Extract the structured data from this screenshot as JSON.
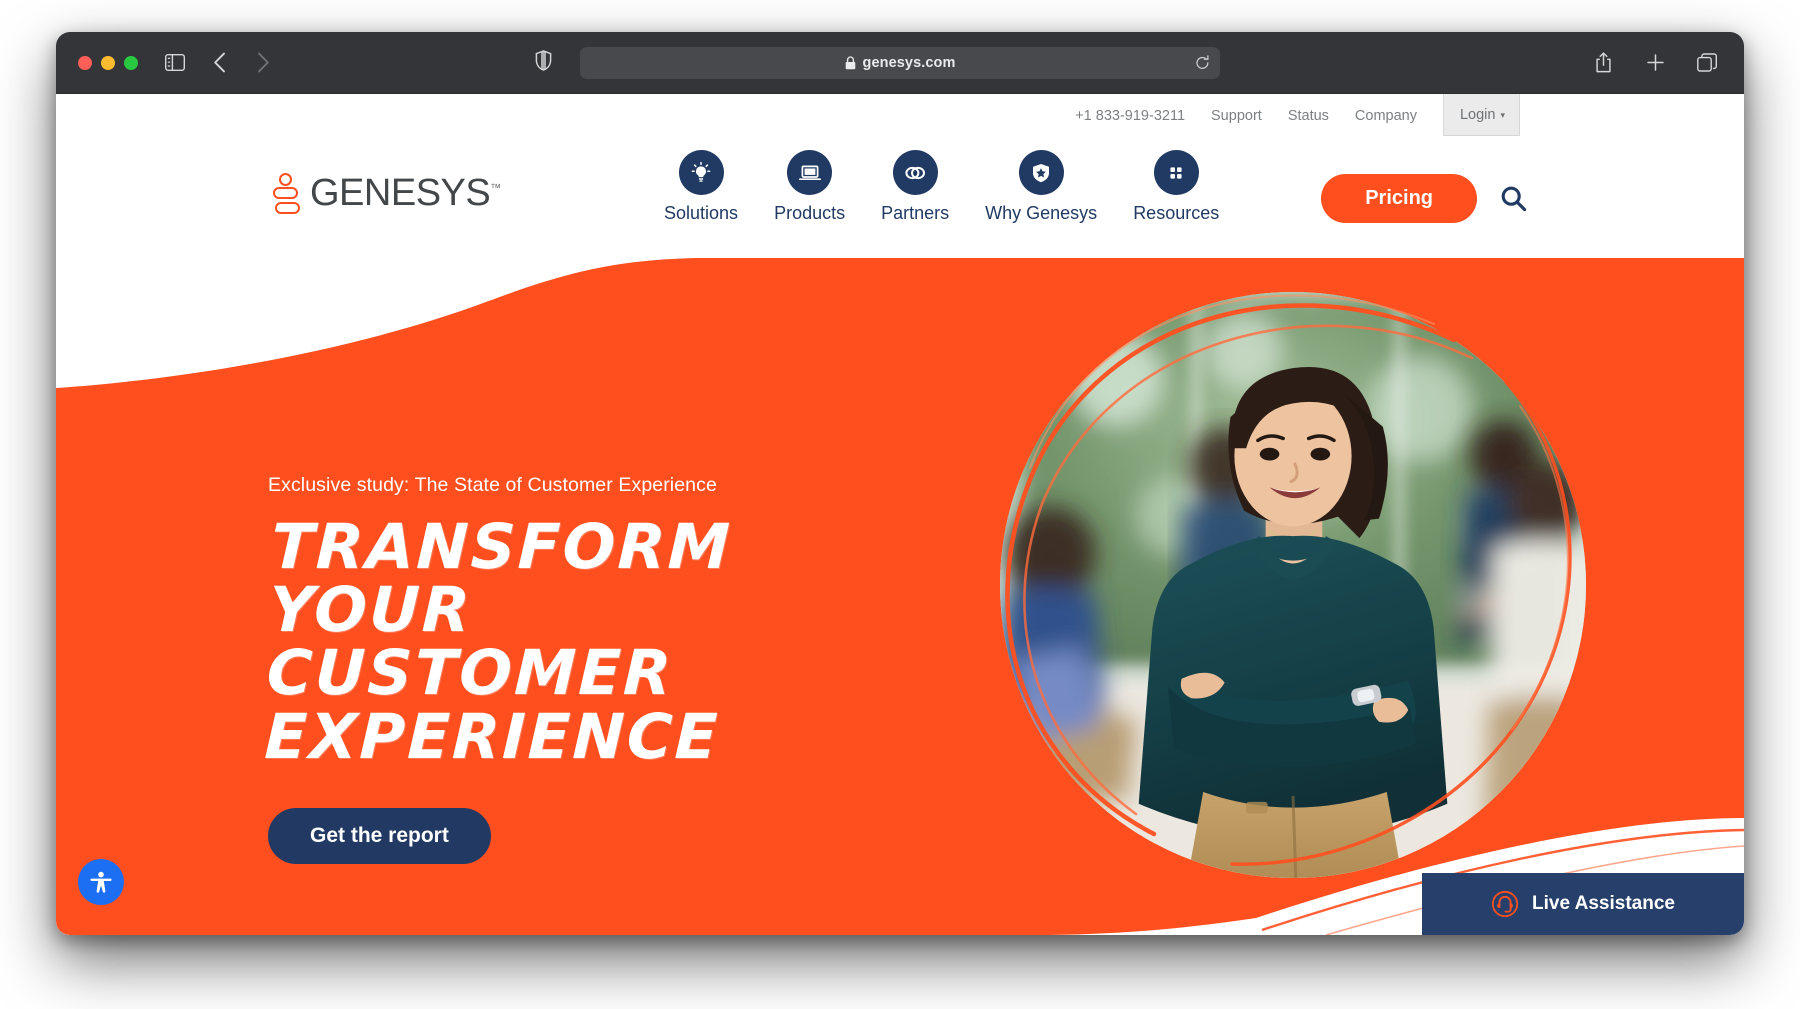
{
  "browser": {
    "app": "Safari",
    "traffic_lights": [
      "close",
      "minimize",
      "zoom"
    ],
    "sidebar_icon": "sidebar-icon",
    "back_icon": "chevron-left-icon",
    "forward_icon": "chevron-right-icon",
    "shield_icon": "privacy-shield-icon",
    "lock_icon": "lock-icon",
    "url": "genesys.com",
    "reload_icon": "reload-icon",
    "share_icon": "share-icon",
    "new_tab_icon": "plus-icon",
    "tab_overview_icon": "tab-overview-icon"
  },
  "utility_nav": {
    "phone": "+1 833-919-3211",
    "links": [
      "Support",
      "Status",
      "Company"
    ],
    "login_label": "Login",
    "login_caret": "▾"
  },
  "logo": {
    "wordmark": "GENESYS",
    "trademark": "™",
    "mark_color": "#ff4f1f",
    "word_color": "#444749"
  },
  "primary_nav": [
    {
      "label": "Solutions",
      "icon": "lightbulb-icon"
    },
    {
      "label": "Products",
      "icon": "laptop-icon"
    },
    {
      "label": "Partners",
      "icon": "interlocking-rings-icon"
    },
    {
      "label": "Why Genesys",
      "icon": "shield-star-icon"
    },
    {
      "label": "Resources",
      "icon": "grid-dots-icon"
    }
  ],
  "header_right": {
    "pricing_label": "Pricing",
    "search_icon": "search-icon"
  },
  "hero": {
    "eyebrow": "Exclusive study: The State of Customer Experience",
    "headline_line1": "Transform your",
    "headline_line2": "customer experience",
    "cta_label": "Get the report",
    "background_color": "#ff4f1f",
    "cta_color": "#223a63",
    "image_alt": "smiling-woman-arms-crossed-office"
  },
  "accessibility": {
    "icon": "accessibility-person-icon",
    "color": "#1c6ef2"
  },
  "live_assistance": {
    "label": "Live Assistance",
    "icon": "headset-icon",
    "background": "#27406b",
    "icon_color": "#ff4f1f"
  },
  "colors": {
    "brand_orange": "#ff4f1f",
    "brand_navy": "#213a63",
    "toolbar_gray": "#333538"
  }
}
